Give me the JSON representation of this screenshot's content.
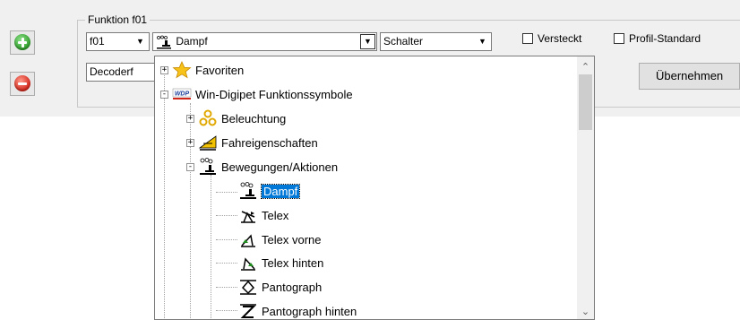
{
  "group": {
    "title": "Funktion f01",
    "function_combo": "f01",
    "icon_combo": "Dampf",
    "type_combo": "Schalter",
    "decoder_field": "Decoderf",
    "hidden_checkbox": "Versteckt",
    "profile_checkbox": "Profil-Standard",
    "apply_button": "Übernehmen"
  },
  "tree": {
    "items": [
      {
        "label": "Favoriten",
        "icon": "star-icon",
        "expander": "+"
      },
      {
        "label": "Win-Digipet Funktionssymbole",
        "icon": "wdp-logo-icon",
        "expander": "-"
      },
      {
        "label": "Beleuchtung",
        "icon": "lights-icon",
        "expander": "+"
      },
      {
        "label": "Fahreigenschaften",
        "icon": "ramp-icon",
        "expander": "+"
      },
      {
        "label": "Bewegungen/Aktionen",
        "icon": "steam-icon",
        "expander": "-"
      },
      {
        "label": "Dampf",
        "icon": "steam-icon",
        "selected": true
      },
      {
        "label": "Telex",
        "icon": "telex-icon"
      },
      {
        "label": "Telex vorne",
        "icon": "telex-front-icon"
      },
      {
        "label": "Telex hinten",
        "icon": "telex-rear-icon"
      },
      {
        "label": "Pantograph",
        "icon": "pantograph-icon"
      },
      {
        "label": "Pantograph hinten",
        "icon": "pantograph-rear-icon"
      }
    ]
  },
  "colors": {
    "selection": "#0078d7",
    "panel": "#f0f0f0",
    "add_green": "#2f9e2a",
    "remove_red": "#d3261a"
  }
}
